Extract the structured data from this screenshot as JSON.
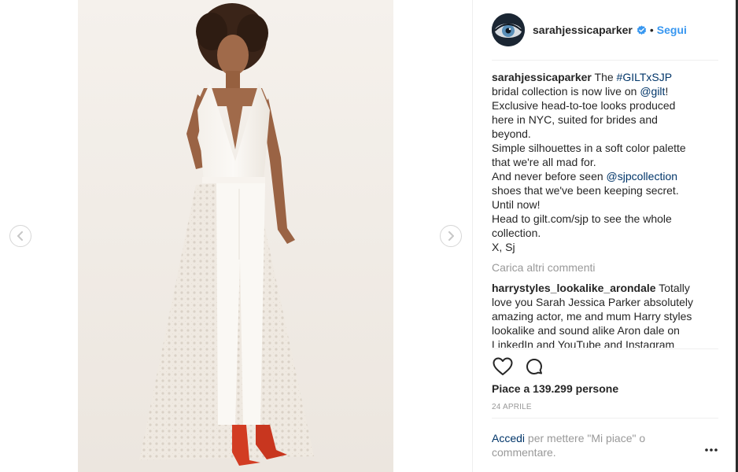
{
  "post": {
    "username": "sarahjessicaparker",
    "follow_label": "Segui",
    "separator": "•",
    "verified_icon": "verified-badge-icon"
  },
  "caption": {
    "author": "sarahjessicaparker",
    "line1_pre": " The ",
    "hashtag": "#GILTxSJP",
    "line2_pre": "bridal collection is now live on ",
    "mention_gilt": "@gilt",
    "line2_post": "!",
    "line3": "Exclusive head-to-toe looks produced",
    "line4": "here in NYC, suited for brides and",
    "line5": "beyond.",
    "line6": "Simple silhouettes in a soft color palette",
    "line7": "that we're all mad for.",
    "line8_pre": "And never before seen ",
    "mention_sjp": "@sjpcollection",
    "line9": "shoes that we've been keeping secret.",
    "line10": "Until now!",
    "line11": "Head to gilt.com/sjp to see the whole",
    "line12": "collection.",
    "line13": "X, Sj"
  },
  "load_more_label": "Carica altri commenti",
  "comment": {
    "author": "harrystyles_lookalike_arondale",
    "line1": " Totally",
    "line2": "love you Sarah Jessica Parker absolutely",
    "line3": "amazing actor, me and mum Harry styles",
    "line4": "lookalike and sound alike Aron dale on",
    "line5": "LinkedIn and YouTube and Instagram"
  },
  "actions": {
    "like_icon": "heart-icon",
    "comment_icon": "comment-bubble-icon"
  },
  "likes_label": "Piace a 139.299 persone",
  "date_label": "24 APRILE",
  "login": {
    "link": "Accedi",
    "text": " per mettere \"Mi piace\" o commentare."
  },
  "more_options_label": "•••",
  "colors": {
    "accent": "#3897f0",
    "link": "#003569",
    "muted": "#999999",
    "text": "#262626"
  }
}
